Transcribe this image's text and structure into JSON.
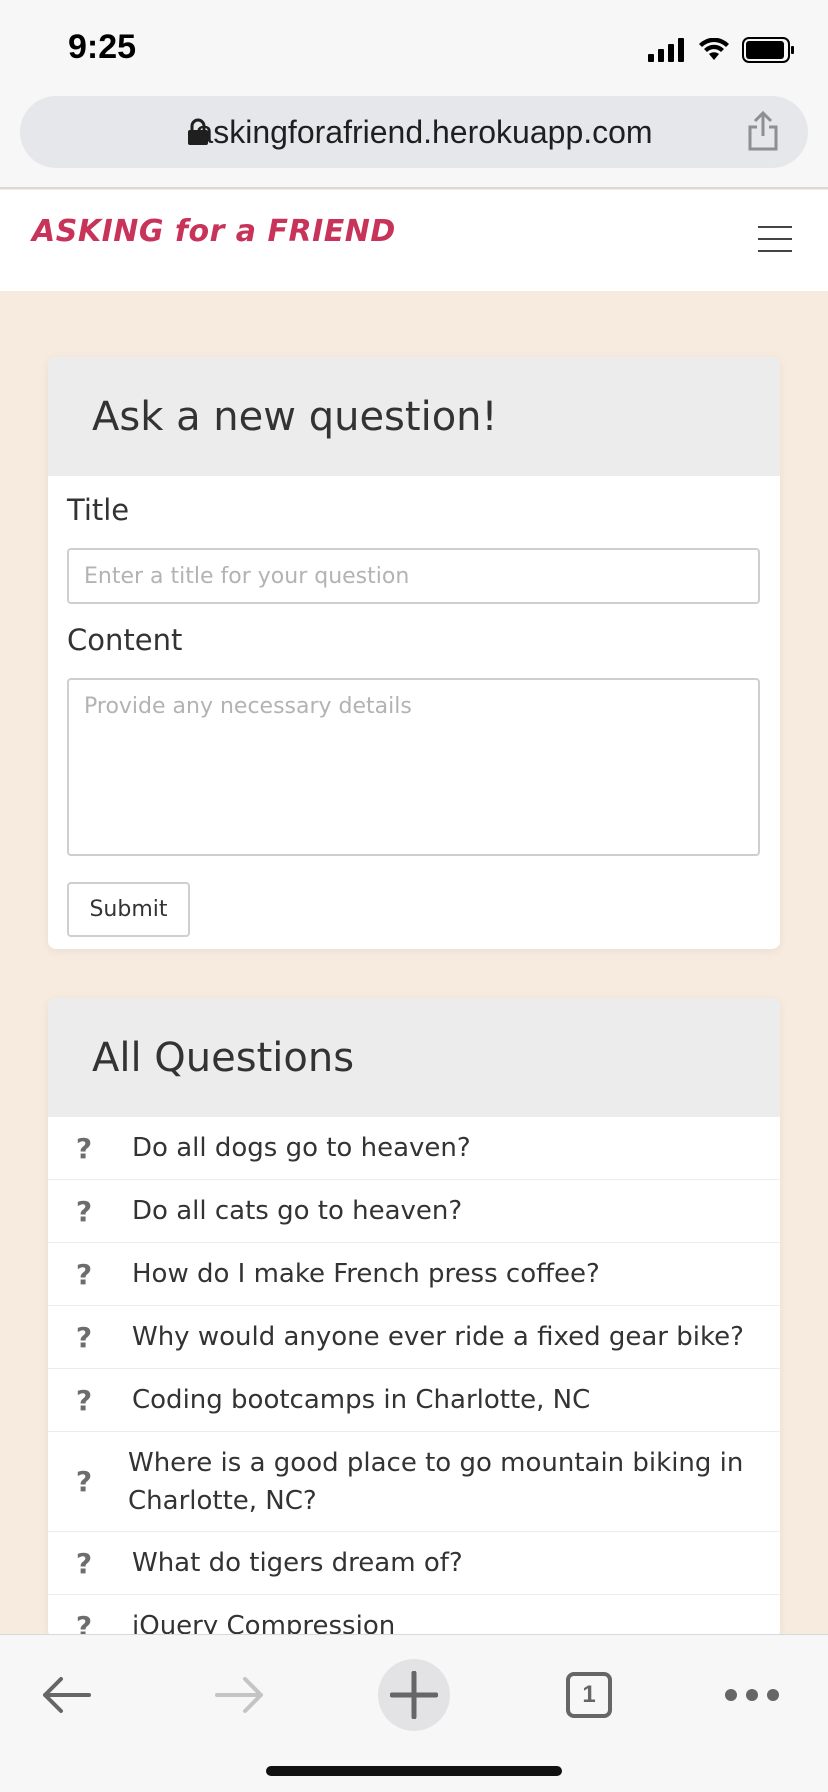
{
  "status_bar": {
    "time": "9:25"
  },
  "browser": {
    "url": "askingforafriend.herokuapp.com"
  },
  "app": {
    "logo": "ASKING for a FRIEND"
  },
  "new_question": {
    "heading": "Ask a new question!",
    "title_label": "Title",
    "title_placeholder": "Enter a title for your question",
    "content_label": "Content",
    "content_placeholder": "Provide any necessary details",
    "submit_label": "Submit"
  },
  "all_questions": {
    "heading": "All Questions",
    "icon_glyph": "?",
    "items": [
      {
        "text": "Do all dogs go to heaven?"
      },
      {
        "text": "Do all cats go to heaven?"
      },
      {
        "text": "How do I make French press coffee?"
      },
      {
        "text": "Why would anyone ever ride a fixed gear bike?"
      },
      {
        "text": "Coding bootcamps in Charlotte, NC"
      },
      {
        "text": "Where is a good place to go mountain biking in Charlotte, NC?"
      },
      {
        "text": "What do tigers dream of?"
      },
      {
        "text": "jQuery Compression"
      }
    ]
  },
  "toolbar": {
    "tab_count": "1"
  },
  "colors": {
    "page_background": "#f7ebdf",
    "brand": "#c8335a",
    "card_header": "#ececec"
  }
}
